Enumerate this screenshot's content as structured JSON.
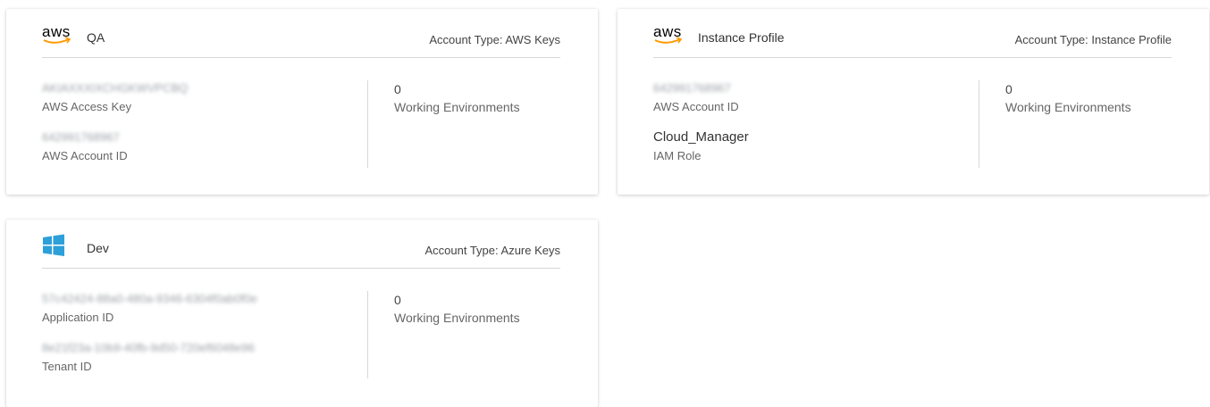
{
  "cards": [
    {
      "name": "QA",
      "logo": "aws-logo",
      "logo_text": "aws",
      "account_type": "Account Type: AWS Keys",
      "fields": [
        {
          "value": "AKIAXXXIXCHGKWVPCBQ",
          "label": "AWS Access Key",
          "blurred": true
        },
        {
          "value": "642991768967",
          "label": "AWS Account ID",
          "blurred": true
        }
      ],
      "stat": {
        "value": "0",
        "label": "Working Environments"
      }
    },
    {
      "name": "Instance Profile",
      "logo": "aws-logo",
      "logo_text": "aws",
      "account_type": "Account Type: Instance Profile",
      "fields": [
        {
          "value": "642991768967",
          "label": "AWS Account ID",
          "blurred": true
        },
        {
          "value": "Cloud_Manager",
          "label": "IAM Role",
          "blurred": false
        }
      ],
      "stat": {
        "value": "0",
        "label": "Working Environments"
      }
    },
    {
      "name": "Dev",
      "logo": "windows-logo",
      "account_type": "Account Type: Azure Keys",
      "fields": [
        {
          "value": "57c42424-88a0-480a-9346-6304f0ab0f0e",
          "label": "Application ID",
          "blurred": true
        },
        {
          "value": "8e21f23a-10b9-40fb-9d50-720ef6048e96",
          "label": "Tenant ID",
          "blurred": true
        }
      ],
      "stat": {
        "value": "0",
        "label": "Working Environments"
      }
    }
  ],
  "colors": {
    "aws_smile": "#f90",
    "windows_blue": "#2d9fd9"
  }
}
